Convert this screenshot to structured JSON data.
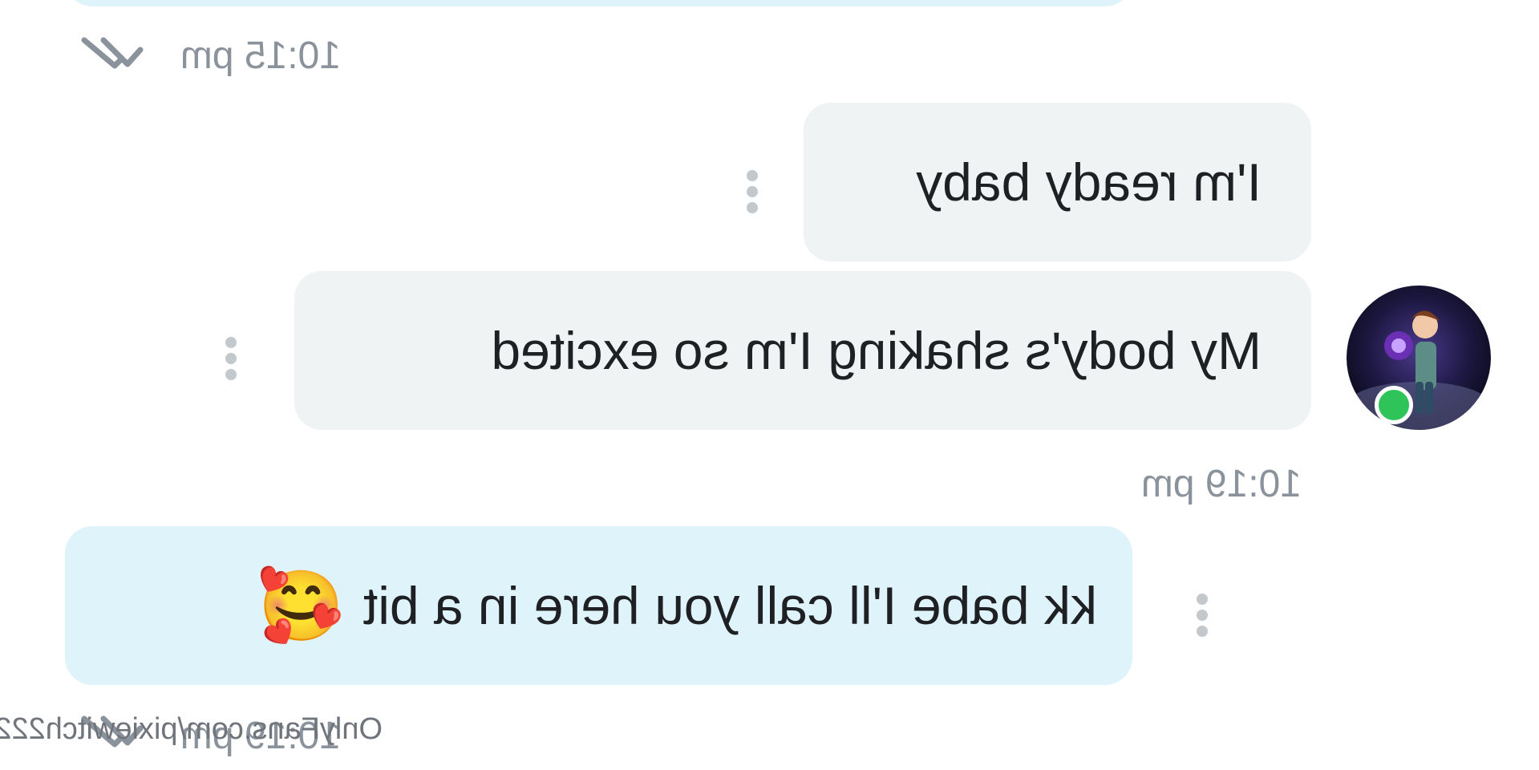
{
  "messages": [
    {
      "id": "out-top",
      "direction": "outgoing",
      "text": "",
      "time": "10:15 pm",
      "status": "read"
    },
    {
      "id": "in-1",
      "direction": "incoming",
      "text": "I'm ready baby"
    },
    {
      "id": "in-2",
      "direction": "incoming",
      "text": "My body's shaking I'm so excited",
      "time": "10:19 pm"
    },
    {
      "id": "out-2",
      "direction": "outgoing",
      "text": "kk babe I'll call you here in a bit",
      "emoji": "🥰",
      "time": "10:19 pm",
      "status": "read"
    }
  ],
  "sender": {
    "avatar": "cartoon-avatar",
    "online": true
  },
  "watermark": "OnlyFans.com/pixiewitch222",
  "icons": {
    "options": "kebab-menu-icon",
    "read": "double-check-icon"
  },
  "colors": {
    "incoming_bubble": "#f0f3f4",
    "outgoing_bubble": "#dff4fa",
    "time_text": "#8a929b",
    "online": "#2fc45a"
  }
}
